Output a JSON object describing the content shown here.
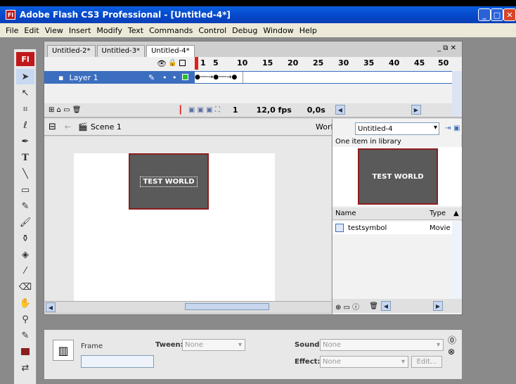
{
  "window": {
    "title": "Adobe Flash CS3 Professional - [Untitled-4*]",
    "app_icon": "Fl"
  },
  "menu": [
    "File",
    "Edit",
    "View",
    "Insert",
    "Modify",
    "Text",
    "Commands",
    "Control",
    "Debug",
    "Window",
    "Help"
  ],
  "toolbar": {
    "logo": "Fl"
  },
  "tabs": [
    "Untitled-2*",
    "Untitled-3*",
    "Untitled-4*"
  ],
  "timeline": {
    "frame_numbers": [
      "1",
      "5",
      "10",
      "15",
      "20",
      "25",
      "30",
      "35",
      "40",
      "45",
      "50"
    ],
    "layer_name": "Layer 1",
    "current_frame": "1",
    "fps": "12,0 fps",
    "time": "0,0s"
  },
  "editbar": {
    "scene": "Scene 1",
    "workspace_label": "Worl"
  },
  "stage": {
    "symbol_text": "TEST WORLD",
    "instance_text": "TEST WORLD"
  },
  "library": {
    "doc_select": "Untitled-4",
    "count_text": "One item in library",
    "preview_text": "TEST WORLD",
    "col_name": "Name",
    "col_type": "Type",
    "item_name": "testsymbol",
    "item_type": "Movie"
  },
  "properties": {
    "frame_label": "Frame",
    "tween_label": "Tween:",
    "tween_value": "None",
    "sound_label": "Sound:",
    "sound_value": "None",
    "effect_label": "Effect:",
    "effect_value": "None",
    "edit_button": "Edit..."
  },
  "colors": {
    "titlebar": "#0546c8",
    "layer_selected": "#3c6ebf",
    "symbol_fill": "#5a5a5a",
    "symbol_border": "#8a1e1e",
    "playhead": "#e02020"
  }
}
